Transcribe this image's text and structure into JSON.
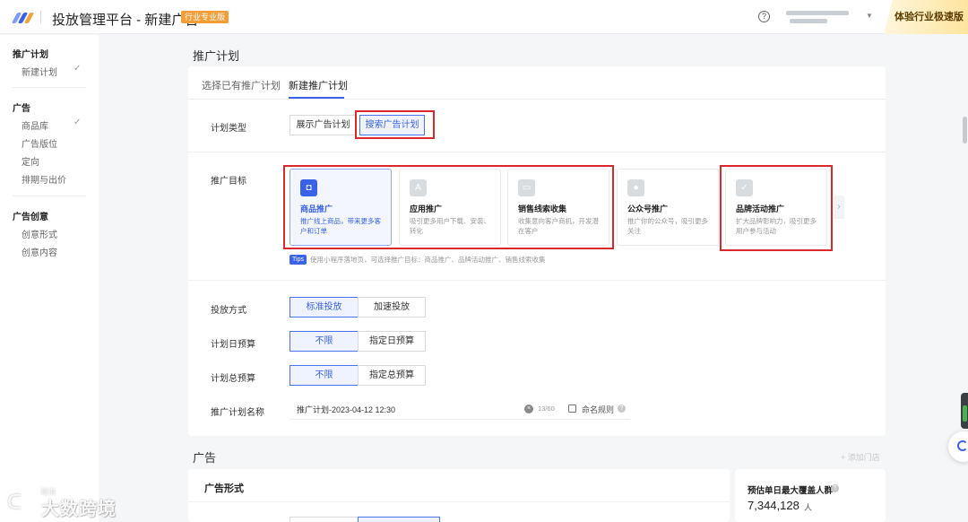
{
  "header": {
    "app_title": "投放管理平台 - 新建广告",
    "edition_badge": "行业专业版",
    "help_symbol": "?",
    "upgrade_label": "体验行业极速版",
    "brand_colors": [
      "#3a62e8",
      "#f29d38",
      "#2f3f9e"
    ]
  },
  "sidebar": {
    "groups": [
      {
        "title": "推广计划",
        "items": [
          {
            "label": "新建计划",
            "done": true
          }
        ]
      },
      {
        "title": "广告",
        "items": [
          {
            "label": "商品库",
            "done": true
          },
          {
            "label": "广告版位",
            "done": false
          },
          {
            "label": "定向",
            "done": false
          },
          {
            "label": "排期与出价",
            "done": false
          }
        ]
      },
      {
        "title": "广告创意",
        "items": [
          {
            "label": "创意形式",
            "done": false
          },
          {
            "label": "创意内容",
            "done": false
          }
        ]
      }
    ],
    "check_symbol": "✓"
  },
  "plan_section": {
    "title": "推广计划",
    "tabs": [
      {
        "label": "选择已有推广计划",
        "active": false
      },
      {
        "label": "新建推广计划",
        "active": true
      }
    ],
    "plan_type": {
      "label": "计划类型",
      "options": [
        "展示广告计划",
        "搜索广告计划"
      ],
      "selected": "搜索广告计划"
    },
    "goal": {
      "label": "推广目标",
      "cards": [
        {
          "title": "商品推广",
          "desc": "推广线上商品，带来更多客户和订单",
          "icon": "shopping-bag-icon",
          "glyph": "◘",
          "selected": true
        },
        {
          "title": "应用推广",
          "desc": "吸引更多用户下载、安装、转化",
          "icon": "app-store-icon",
          "glyph": "A",
          "selected": false
        },
        {
          "title": "销售线索收集",
          "desc": "收集意向客户商机，开发潜在客户",
          "icon": "leads-image-icon",
          "glyph": "▭",
          "selected": false
        },
        {
          "title": "公众号推广",
          "desc": "推广你的公众号，吸引更多关注",
          "icon": "official-account-icon",
          "glyph": "●",
          "selected": false
        },
        {
          "title": "品牌活动推广",
          "desc": "扩大品牌影响力，吸引更多用户参与活动",
          "icon": "brand-chat-icon",
          "glyph": "✓",
          "selected": false
        }
      ],
      "next_arrow": "›",
      "tips_badge": "Tips",
      "tips_text": "使用小程序落地页，可选择推广目标：商品推广、品牌活动推广、销售线索收集"
    },
    "delivery_mode": {
      "label": "投放方式",
      "options": [
        "标准投放",
        "加速投放"
      ],
      "selected": "标准投放"
    },
    "daily_budget": {
      "label": "计划日预算",
      "options": [
        "不限",
        "指定日预算"
      ],
      "selected": "不限"
    },
    "total_budget": {
      "label": "计划总预算",
      "options": [
        "不限",
        "指定总预算"
      ],
      "selected": "不限"
    },
    "plan_name": {
      "label": "推广计划名称",
      "value": "推广计划-2023-04-12 12:30",
      "counter": "13/60",
      "rule_label": "命名规则",
      "clear_symbol": "×",
      "help_symbol": "?"
    }
  },
  "ad_section": {
    "title": "广告",
    "add_store": "+ 添加门店",
    "format_title": "广告形式",
    "estimate_label": "预估单日最大覆盖人群",
    "estimate_value": "7,344,128",
    "estimate_unit": "人",
    "help_symbol": "?"
  },
  "watermark": {
    "small": "取消",
    "main": "大数跨境",
    "logo_glyph": "ᑕ"
  }
}
